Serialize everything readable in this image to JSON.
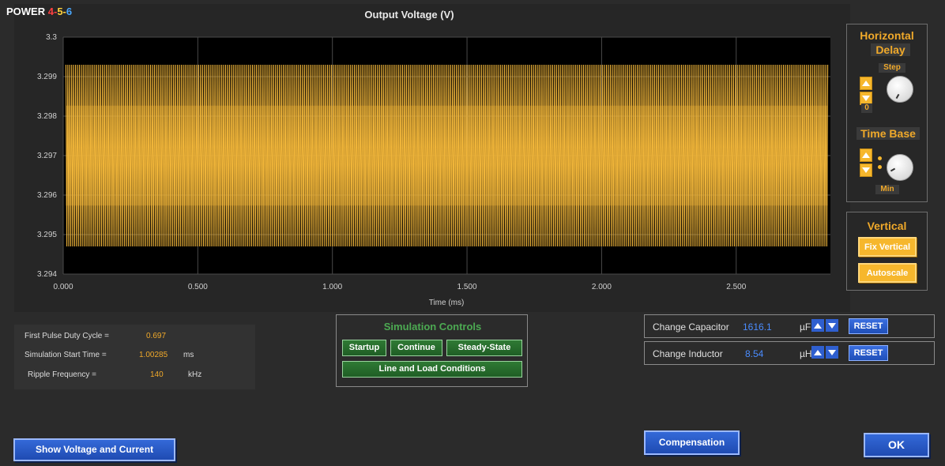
{
  "brand": {
    "word": "POWER ",
    "n4": "4",
    "sep1": "-",
    "n5": "5",
    "sep2": "-",
    "n6": "6"
  },
  "chart_data": {
    "type": "line",
    "title": "Output Voltage (V)",
    "xlabel": "Time (ms)",
    "ylabel": "",
    "xlim": [
      0,
      2.85
    ],
    "ylim": [
      3.294,
      3.3
    ],
    "x_ticks": [
      "0.000",
      "0.500",
      "1.000",
      "1.500",
      "2.000",
      "2.500"
    ],
    "y_ticks": [
      "3.3",
      "3.299",
      "3.298",
      "3.297",
      "3.296",
      "3.295",
      "3.294"
    ],
    "grid": true,
    "series": [
      {
        "color": "#f0b53a",
        "x_start": 0.01,
        "x_end": 2.84,
        "y_min": 3.2947,
        "y_max": 3.2993,
        "ripple_frequency_khz": 140
      }
    ]
  },
  "horizontal": {
    "title_line1": "Horizontal",
    "title_line2": "Delay",
    "step_label": "Step",
    "delay_value": "0"
  },
  "timebase": {
    "title": "Time Base",
    "value_label": "Min"
  },
  "vertical": {
    "title": "Vertical",
    "fix_btn": "Fix Vertical",
    "autoscale_btn": "Autoscale"
  },
  "info": {
    "duty_label": "First  Pulse Duty Cycle =",
    "duty_value": "0.697",
    "start_label": "Simulation  Start Time =",
    "start_value": "1.00285",
    "start_unit": "ms",
    "ripple_label": "Ripple  Frequency  =",
    "ripple_value": "140",
    "ripple_unit": "kHz"
  },
  "sim": {
    "title": "Simulation Controls",
    "startup": "Startup",
    "continue": "Continue",
    "steady": "Steady-State",
    "line_load": "Line and Load Conditions"
  },
  "capacitor": {
    "label": "Change Capacitor",
    "value": "1616.1",
    "unit": "µF",
    "reset": "RESET"
  },
  "inductor": {
    "label": "Change Inductor",
    "value": "8.54",
    "unit": "µH",
    "reset": "RESET"
  },
  "buttons": {
    "show_vi": "Show Voltage and Current",
    "compensation": "Compensation",
    "ok": "OK"
  },
  "colors": {
    "accent": "#f0a92a",
    "trace": "#f0b53a",
    "green": "#2f7a34",
    "blue": "#2f5fcf"
  }
}
